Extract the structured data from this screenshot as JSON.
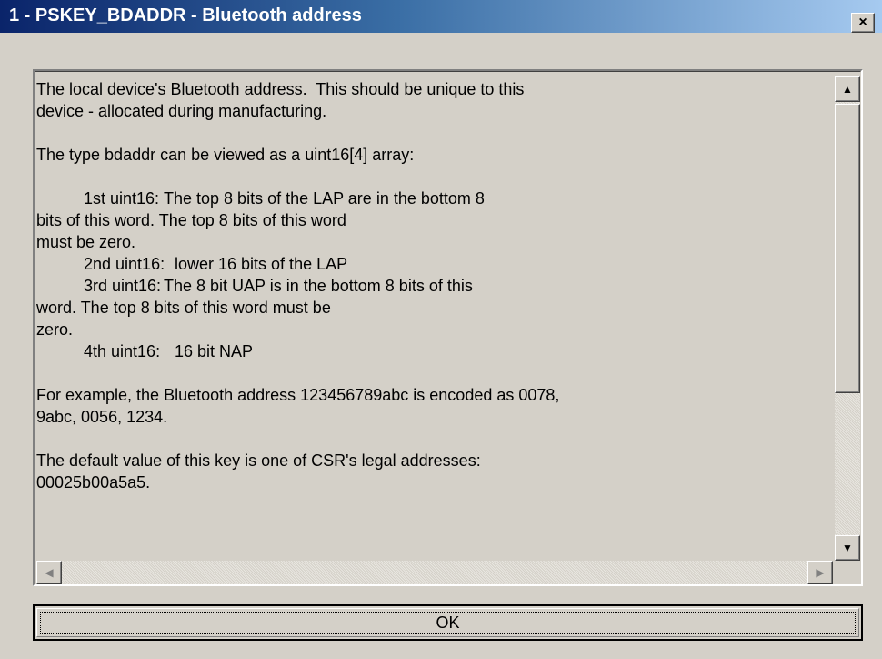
{
  "window": {
    "title": "1 - PSKEY_BDADDR - Bluetooth address",
    "close_glyph": "×"
  },
  "content": {
    "para1": "The local device's Bluetooth address.  This should be unique to this\ndevice - allocated during manufacturing.",
    "para2": "The type bdaddr can be viewed as a uint16[4] array:",
    "fields": [
      {
        "label": "1st uint16:",
        "lines": [
          "The top 8 bits of the LAP are in the bottom 8",
          "bits of this word. The top 8 bits of this word",
          "must be zero."
        ]
      },
      {
        "label": "2nd uint16:",
        "lines": [
          "lower 16 bits of the LAP"
        ]
      },
      {
        "label": "3rd uint16:",
        "lines": [
          "The 8 bit UAP is in the bottom 8 bits of this",
          "word. The top 8 bits of this word must be",
          "zero."
        ]
      },
      {
        "label": "4th uint16:",
        "lines": [
          "16 bit NAP"
        ]
      }
    ],
    "para3": "For example, the Bluetooth address 123456789abc is encoded as 0078,\n9abc, 0056, 1234.",
    "para4": "The default value of this key is one of CSR's legal addresses:\n00025b00a5a5."
  },
  "scrollbars": {
    "up_arrow": "▲",
    "down_arrow": "▼",
    "left_arrow": "◀",
    "right_arrow": "▶"
  },
  "ok_button": {
    "label": "OK"
  }
}
